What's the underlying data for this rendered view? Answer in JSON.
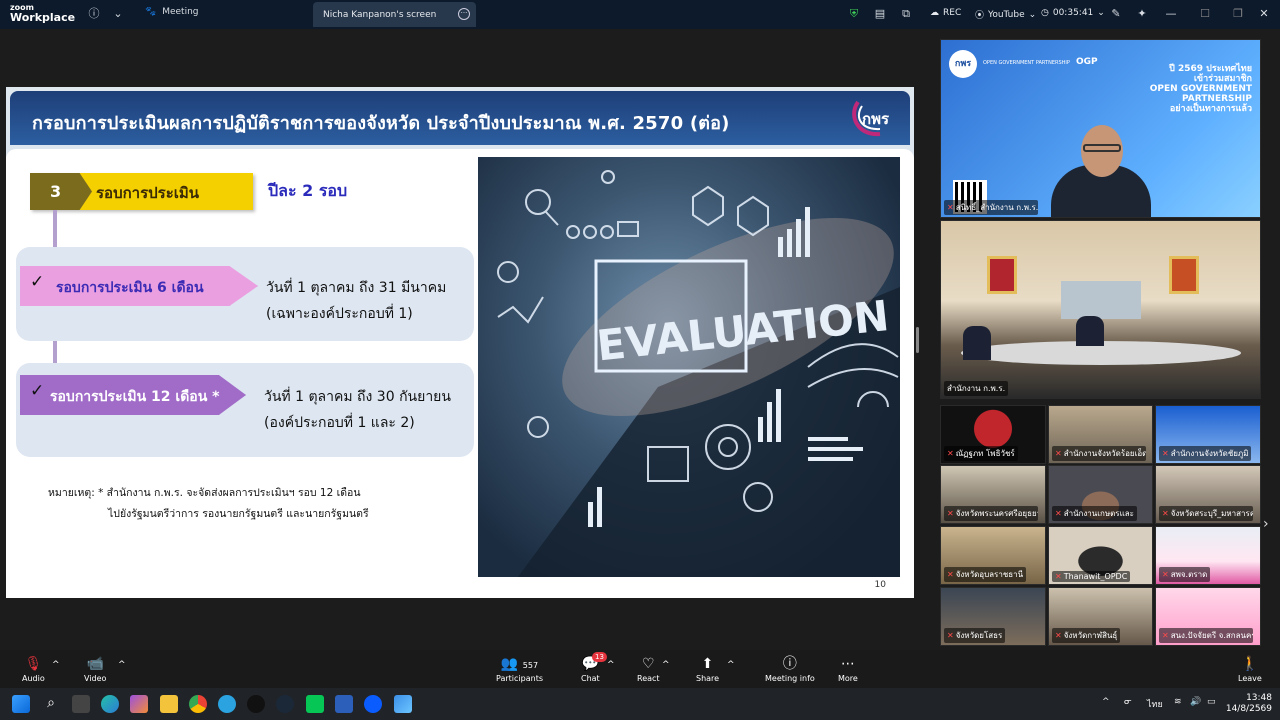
{
  "app": {
    "logo_line1": "zoom",
    "logo_line2": "Workplace",
    "meeting_tab": "Meeting",
    "share_tab": "Nicha Kanpanon's screen",
    "rec": "REC",
    "youtube": "YouTube",
    "timer": "00:35:41"
  },
  "slide": {
    "title": "กรอบการประเมินผลการปฏิบัติราชการของจังหวัด ประจำปีงบประมาณ พ.ศ. 2570 (ต่อ)",
    "logo_text": "กพร",
    "step_number": "3",
    "step_label": "รอบการประเมิน",
    "yearly": "ปีละ 2 รอบ",
    "rounds": [
      {
        "label": "รอบการประเมิน 6 เดือน",
        "line1": "วันที่ 1 ตุลาคม ถึง 31 มีนาคม",
        "line2": "(เฉพาะองค์ประกอบที่ 1)",
        "color": "#eaa0e0",
        "text_color": "#3b2bb5"
      },
      {
        "label": "รอบการประเมิน 12 เดือน *",
        "line1": "วันที่ 1 ตุลาคม ถึง 30 กันยายน",
        "line2": "(องค์ประกอบที่ 1 และ 2)",
        "color": "#a06cc8",
        "text_color": "#ffffff"
      }
    ],
    "note_line1": "หมายเหตุ: * สำนักงาน ก.พ.ร. จะจัดส่งผลการประเมินฯ รอบ 12 เดือน",
    "note_line2": "ไปยังรัฐมนตรีว่าการ รองนายกรัฐมนตรี และนายกรัฐมนตรี",
    "image_word": "EVALUATION",
    "page_number": "10"
  },
  "banner": {
    "ogp": "OPEN GOVERNMENT PARTNERSHIP",
    "ogp_short": "OGP",
    "line1": "ปี 2569 ประเทศไทย",
    "line2": "เข้าร่วมสมาชิก",
    "line3": "OPEN GOVERNMENT",
    "line4": "PARTNERSHIP",
    "line5": "อย่างเป็นทางการแล้ว"
  },
  "tiles": [
    {
      "name": "สนิทธิ์_สำนักงาน ก.พ.ร."
    },
    {
      "name": "สำนักงาน ก.พ.ร."
    },
    {
      "name": "ณัฏฐภท โพธิวัชร์"
    },
    {
      "name": "สำนักงานจังหวัดร้อยเอ็ด"
    },
    {
      "name": "สำนักงานจังหวัดชัยภูมิ"
    },
    {
      "name": "จังหวัดพระนครศรีอยุธยา"
    },
    {
      "name": "สำนักงานเกษตรและ"
    },
    {
      "name": "จังหวัดสระบุรี_มหาสารคาม"
    },
    {
      "name": "จังหวัดอุบลราชธานี"
    },
    {
      "name": "Thanawit_OPDC"
    },
    {
      "name": "สพจ.ตราด"
    },
    {
      "name": "จังหวัดยโสธร"
    },
    {
      "name": "จังหวัดกาฬสินธุ์"
    },
    {
      "name": "สนง.ปัจจัยตรี จ.สกลนคร"
    }
  ],
  "toolbar": {
    "audio": "Audio",
    "video": "Video",
    "participants": "Participants",
    "participants_count": "557",
    "chat": "Chat",
    "chat_badge": "13",
    "react": "React",
    "share": "Share",
    "meeting_info": "Meeting info",
    "more": "More",
    "leave": "Leave"
  },
  "taskbar": {
    "lang": "ไทย",
    "time": "13:48",
    "date": "14/8/2569"
  }
}
